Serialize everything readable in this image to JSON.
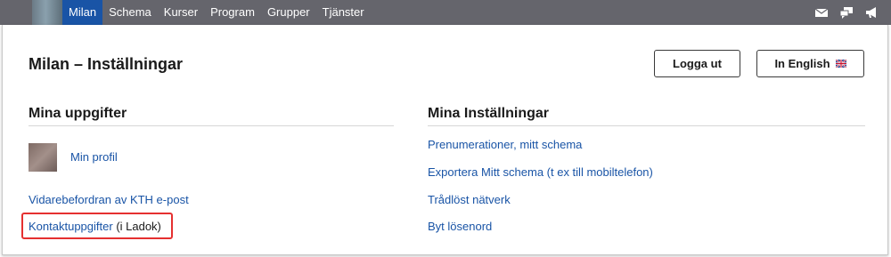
{
  "nav": {
    "items": [
      {
        "label": "Milan",
        "active": true
      },
      {
        "label": "Schema"
      },
      {
        "label": "Kurser"
      },
      {
        "label": "Program"
      },
      {
        "label": "Grupper"
      },
      {
        "label": "Tjänster"
      }
    ],
    "icons": [
      "mail-icon",
      "chat-icon",
      "megaphone-icon"
    ]
  },
  "header": {
    "title": "Milan – Inställningar",
    "logout_label": "Logga ut",
    "english_label": "In English"
  },
  "left": {
    "title": "Mina uppgifter",
    "profile_link": "Min profil",
    "forward_link": "Vidarebefordran av KTH e-post",
    "contact_link": "Kontaktuppgifter",
    "contact_suffix": "(i Ladok)"
  },
  "right": {
    "title": "Mina Inställningar",
    "links": [
      "Prenumerationer, mitt schema",
      "Exportera Mitt schema (t ex till mobiltelefon)",
      "Trådlöst nätverk",
      "Byt lösenord"
    ]
  },
  "colors": {
    "nav_bg": "#65656c",
    "nav_active": "#1954a6",
    "link": "#1954a6",
    "highlight": "#e53030"
  }
}
